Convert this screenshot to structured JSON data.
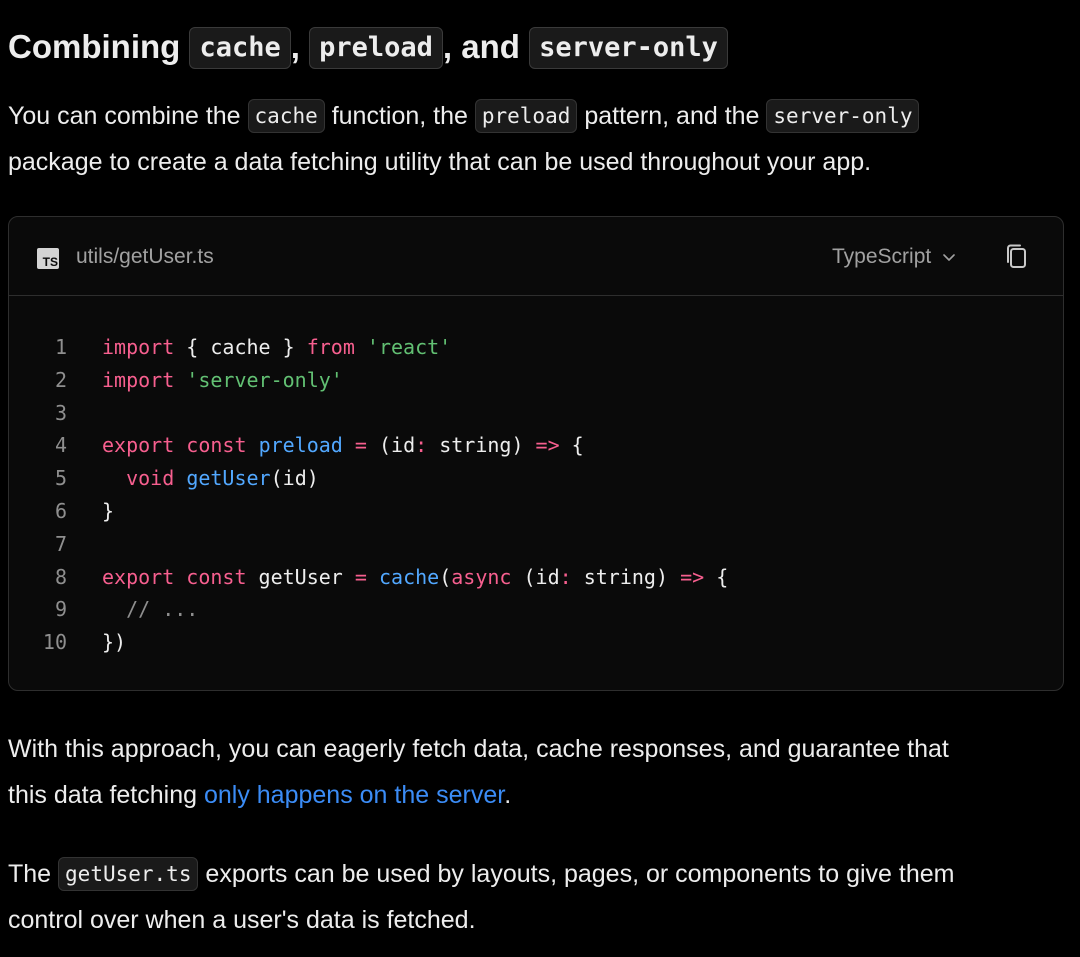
{
  "heading": {
    "prefix": "Combining ",
    "code1": "cache",
    "sep1": ", ",
    "code2": "preload",
    "sep2": ", and ",
    "code3": "server-only"
  },
  "intro": {
    "t1": "You can combine the ",
    "c1": "cache",
    "t2": " function, the ",
    "c2": "preload",
    "t3": " pattern, and the ",
    "c3": "server-only",
    "t4": "package to create a data fetching utility that can be used throughout your app."
  },
  "code_block": {
    "file_icon": "TS",
    "filename": "utils/getUser.ts",
    "language": "TypeScript",
    "chevron_icon": "chevron-down-icon",
    "copy_icon": "copy-icon",
    "line_numbers": [
      "1",
      "2",
      "3",
      "4",
      "5",
      "6",
      "7",
      "8",
      "9",
      "10"
    ],
    "lines": [
      [
        {
          "t": "import",
          "c": "kw"
        },
        {
          "t": " { cache } ",
          "c": "pl"
        },
        {
          "t": "from",
          "c": "kw"
        },
        {
          "t": " ",
          "c": "pl"
        },
        {
          "t": "'react'",
          "c": "str"
        }
      ],
      [
        {
          "t": "import",
          "c": "kw"
        },
        {
          "t": " ",
          "c": "pl"
        },
        {
          "t": "'server-only'",
          "c": "str"
        }
      ],
      [],
      [
        {
          "t": "export",
          "c": "kw"
        },
        {
          "t": " ",
          "c": "pl"
        },
        {
          "t": "const",
          "c": "kw"
        },
        {
          "t": " ",
          "c": "pl"
        },
        {
          "t": "preload",
          "c": "fn"
        },
        {
          "t": " ",
          "c": "pl"
        },
        {
          "t": "=",
          "c": "op"
        },
        {
          "t": " (id",
          "c": "pl"
        },
        {
          "t": ":",
          "c": "op"
        },
        {
          "t": " string) ",
          "c": "pl"
        },
        {
          "t": "=>",
          "c": "op"
        },
        {
          "t": " {",
          "c": "pl"
        }
      ],
      [
        {
          "t": "  ",
          "c": "pl"
        },
        {
          "t": "void",
          "c": "kw"
        },
        {
          "t": " ",
          "c": "pl"
        },
        {
          "t": "getUser",
          "c": "fn"
        },
        {
          "t": "(id)",
          "c": "pl"
        }
      ],
      [
        {
          "t": "}",
          "c": "pl"
        }
      ],
      [],
      [
        {
          "t": "export",
          "c": "kw"
        },
        {
          "t": " ",
          "c": "pl"
        },
        {
          "t": "const",
          "c": "kw"
        },
        {
          "t": " getUser ",
          "c": "pl"
        },
        {
          "t": "=",
          "c": "op"
        },
        {
          "t": " ",
          "c": "pl"
        },
        {
          "t": "cache",
          "c": "fn"
        },
        {
          "t": "(",
          "c": "pl"
        },
        {
          "t": "async",
          "c": "kw"
        },
        {
          "t": " (id",
          "c": "pl"
        },
        {
          "t": ":",
          "c": "op"
        },
        {
          "t": " string) ",
          "c": "pl"
        },
        {
          "t": "=>",
          "c": "op"
        },
        {
          "t": " {",
          "c": "pl"
        }
      ],
      [
        {
          "t": "  // ...",
          "c": "cm"
        }
      ],
      [
        {
          "t": "})",
          "c": "pl"
        }
      ]
    ]
  },
  "approach": {
    "t1": "With this approach, you can eagerly fetch data, cache responses, and guarantee that",
    "t2": "this data fetching ",
    "link": "only happens on the server",
    "t3": "."
  },
  "exports": {
    "t1": "The ",
    "c1": "getUser.ts",
    "t2": " exports can be used by layouts, pages, or components to give them",
    "t3": "control over when a user's data is fetched."
  },
  "colors": {
    "background": "#000000",
    "text": "#ededed",
    "link": "#3b8cf6",
    "keyword": "#f75f8f",
    "string": "#62c073",
    "function": "#52a8ff",
    "comment": "#8f8f8f"
  }
}
